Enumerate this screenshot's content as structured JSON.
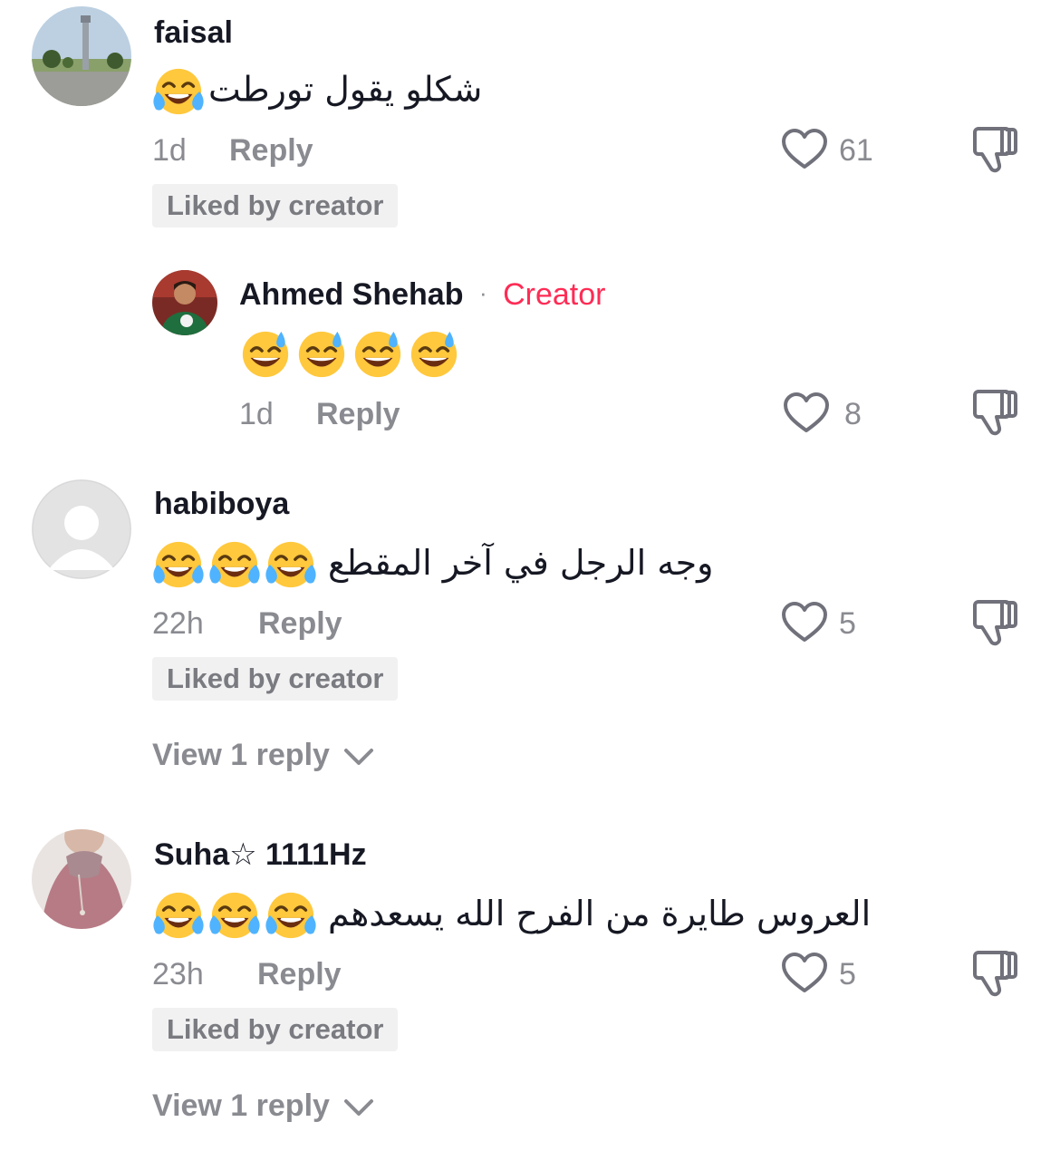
{
  "colors": {
    "text": "#161823",
    "muted": "#8a8b91",
    "accent": "#fe2c55",
    "badge_bg": "#f1f1f2"
  },
  "comments": [
    {
      "username": "faisal",
      "text": "شكلو يقول تورطت",
      "emojis": [
        "tears-of-joy"
      ],
      "time": "1d",
      "reply_label": "Reply",
      "likes": "61",
      "badge": "Liked by creator"
    },
    {
      "username": "Ahmed Shehab",
      "role_separator": "·",
      "role": "Creator",
      "text": "",
      "emojis": [
        "sweat-smile",
        "sweat-smile",
        "sweat-smile",
        "sweat-smile"
      ],
      "time": "1d",
      "reply_label": "Reply",
      "likes": "8"
    },
    {
      "username": "habiboya",
      "text": "وجه الرجل في آخر المقطع",
      "emojis": [
        "tears-of-joy",
        "tears-of-joy",
        "tears-of-joy"
      ],
      "time": "22h",
      "reply_label": "Reply",
      "likes": "5",
      "badge": "Liked by creator",
      "view_replies": "View 1 reply"
    },
    {
      "username": "Suha☆ 1111Hz",
      "text": "العروس طايرة من الفرح الله يسعدهم",
      "emojis": [
        "tears-of-joy",
        "tears-of-joy",
        "tears-of-joy"
      ],
      "time": "23h",
      "reply_label": "Reply",
      "likes": "5",
      "badge": "Liked by creator",
      "view_replies": "View 1 reply"
    }
  ]
}
